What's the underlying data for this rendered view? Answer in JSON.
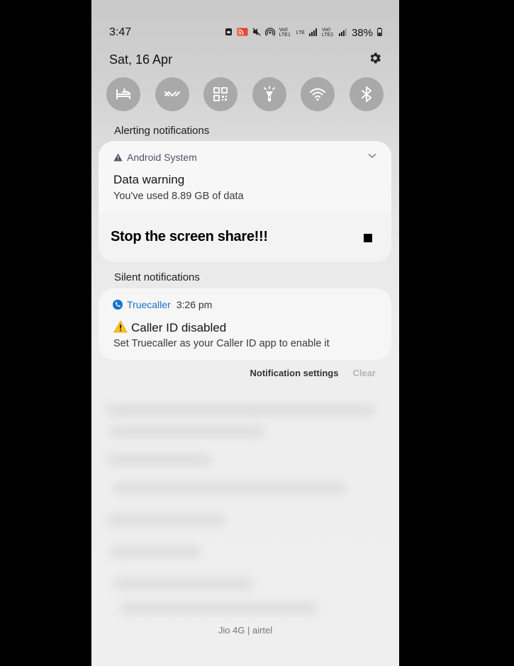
{
  "status_bar": {
    "time": "3:47",
    "battery_percent": "38%",
    "signal_labels": [
      "Vo0 LTE1",
      "LTE",
      "Vo0 LTE2"
    ]
  },
  "header": {
    "date": "Sat, 16 Apr"
  },
  "quick_settings": [
    {
      "name": "sleep-mode",
      "icon": "bed-icon"
    },
    {
      "name": "data-saver",
      "icon": "shuffle-icon"
    },
    {
      "name": "qr-scanner",
      "icon": "qr-code-icon"
    },
    {
      "name": "flashlight",
      "icon": "flashlight-icon"
    },
    {
      "name": "wifi",
      "icon": "wifi-icon"
    },
    {
      "name": "bluetooth",
      "icon": "bluetooth-icon"
    }
  ],
  "alerting": {
    "section_label": "Alerting notifications",
    "app_name": "Android System",
    "title": "Data warning",
    "text": "You've used 8.89 GB of data",
    "share_text": "Stop the screen share!!!"
  },
  "silent": {
    "section_label": "Silent notifications",
    "app_name": "Truecaller",
    "time": "3:26 pm",
    "title": "Caller ID disabled",
    "text": "Set Truecaller as your Caller ID app to enable it"
  },
  "footer": {
    "notification_settings": "Notification settings",
    "clear": "Clear",
    "carrier": "Jio 4G | airtel"
  },
  "colors": {
    "truecaller_blue": "#1a73c8",
    "qs_button": "#a9a9a9",
    "background": "#000000"
  }
}
